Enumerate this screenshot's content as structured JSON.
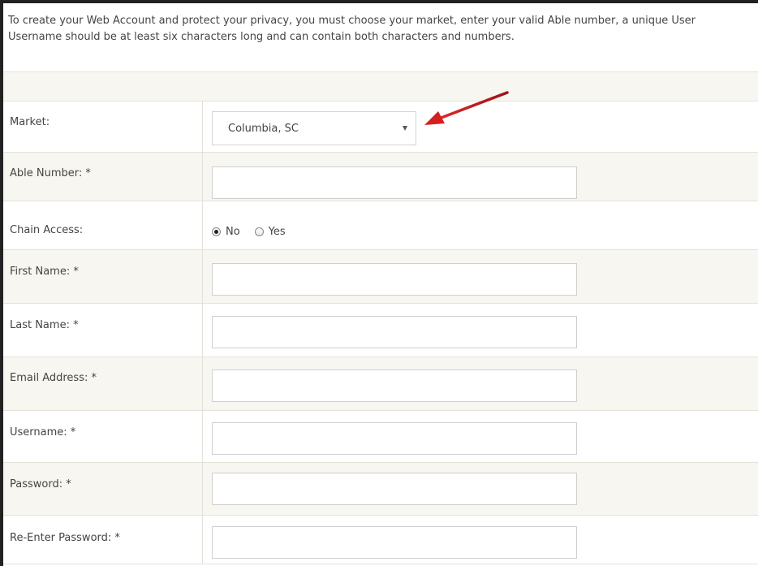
{
  "intro": {
    "line1": "To create your Web Account and protect your privacy, you must choose your market, enter your valid Able number, a unique User",
    "line2": "Username should be at least six characters long and can contain both characters and numbers."
  },
  "form": {
    "market": {
      "label": "Market:",
      "selected_value": "Columbia, SC"
    },
    "able_number": {
      "label": "Able Number: *",
      "value": ""
    },
    "chain_access": {
      "label": "Chain Access:",
      "options": [
        "No",
        "Yes"
      ],
      "selected": "No"
    },
    "first_name": {
      "label": "First Name: *",
      "value": ""
    },
    "last_name": {
      "label": "Last Name: *",
      "value": ""
    },
    "email": {
      "label": "Email Address: *",
      "value": ""
    },
    "username": {
      "label": "Username: *",
      "value": ""
    },
    "password": {
      "label": "Password: *",
      "value": ""
    },
    "reenter_password": {
      "label": "Re-Enter Password: *",
      "value": ""
    }
  },
  "colors": {
    "annotation_arrow": "#d42020",
    "row_alt_bg": "#f7f6f0",
    "border": "#e4e2d8",
    "text": "#444444"
  },
  "icons": {
    "annotation": "red-arrow-icon",
    "dropdown": "chevron-down-icon"
  }
}
